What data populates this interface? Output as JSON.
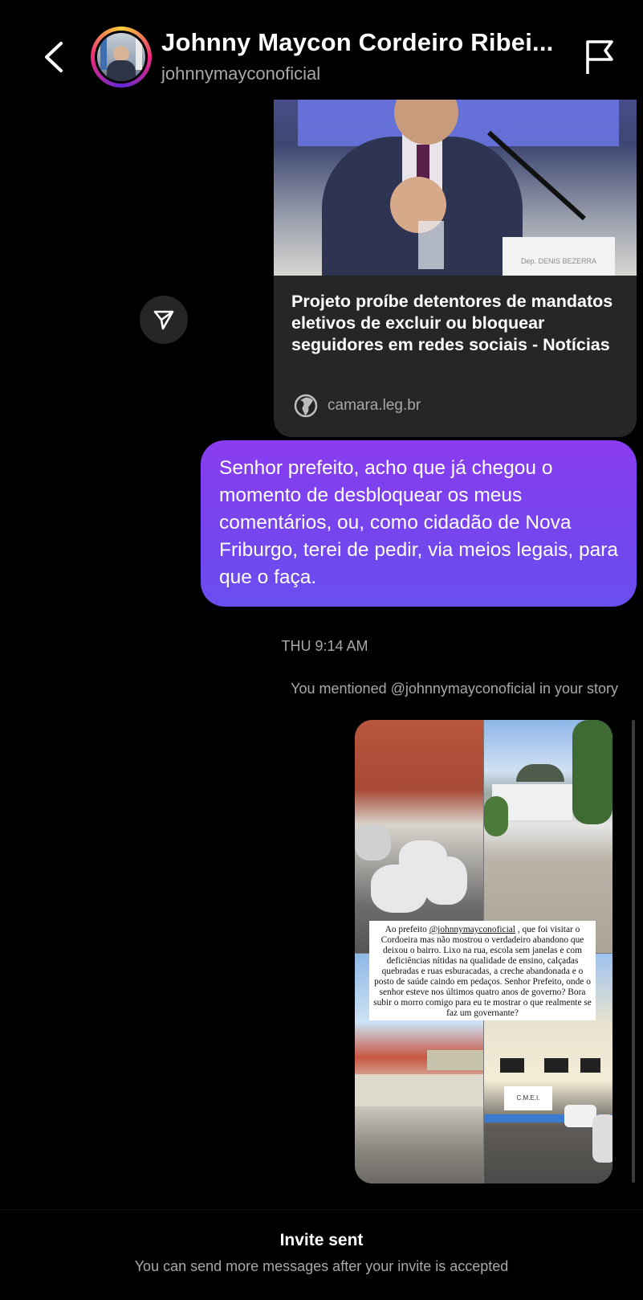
{
  "header": {
    "name": "Johnny Maycon Cordeiro Ribei...",
    "username": "johnnymayconoficial",
    "back_icon": "chevron-left-icon",
    "report_icon": "flag-icon"
  },
  "shared_link": {
    "title": "Projeto proíbe detentores de mandatos eletivos de excluir ou bloquear seguidores em redes sociais - Notícias",
    "domain": "camara.leg.br",
    "photo_nameplate": "Dep. DENIS BEZERRA",
    "domain_icon": "globe-icon",
    "forward_icon": "send-icon"
  },
  "message": {
    "text": "Senhor prefeito, acho que já chegou o momento de desbloquear os meus comentários, ou, como cidadão de Nova Friburgo, terei de pedir, via meios legais, para que o faça.",
    "color_start": "#8a3cf0",
    "color_end": "#6a4ef0"
  },
  "timestamp": "THU 9:14 AM",
  "story_mention": {
    "note": "You mentioned @johnnymayconoficial in your story",
    "caption_prefix": "Ao prefeito ",
    "caption_tag": "@johnnymayconoficial",
    "caption_rest": " , que foi visitar o Cordoeira mas não mostrou o verdadeiro abandono que deixou o bairro. Lixo na rua, escola sem janelas e com deficiências nítidas na qualidade de ensino, calçadas quebradas e ruas esburacadas, a creche abandonada e o posto de saúde caindo em pedaços.  Senhor Prefeito, onde o senhor esteve nos últimos quatro anos de governo? Bora subir o morro comigo para eu te mostrar o que realmente se faz um governante?",
    "building_sign": "C.M.E.I."
  },
  "footer": {
    "title": "Invite sent",
    "subtitle": "You can send more messages after your invite is accepted"
  }
}
